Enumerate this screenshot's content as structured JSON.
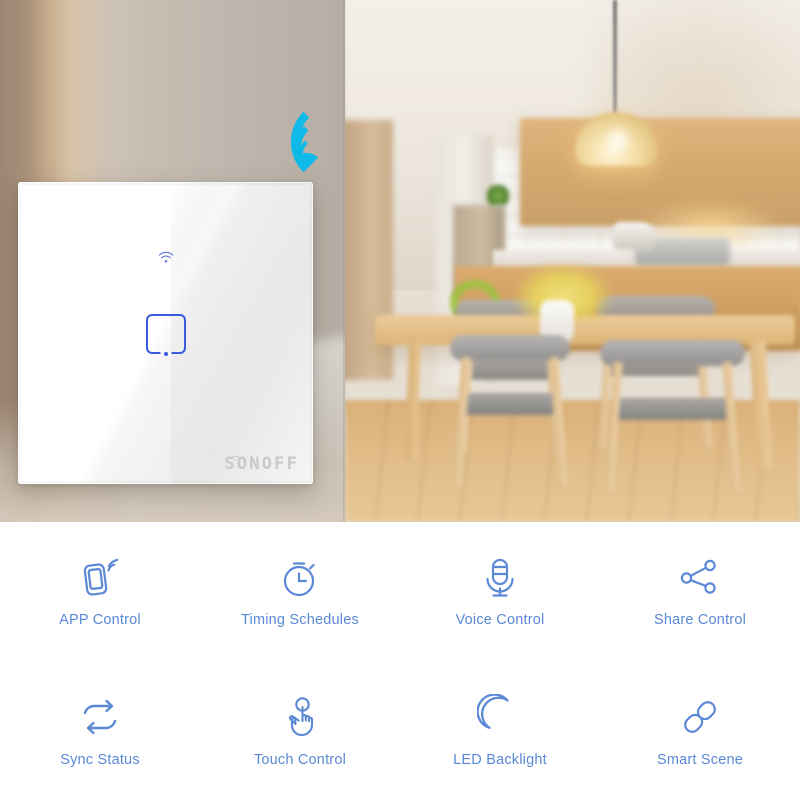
{
  "hero": {
    "wifi_emblem": {
      "icon": "wifi-signal-icon",
      "color": "#0fb9e8",
      "bars": 4
    },
    "scene_description": "Blurred modern kitchen and dining room interior with pendant lamp, wood cabinets, dining table and chairs"
  },
  "device": {
    "name": "sonoff-wall-switch",
    "brand": "SONOFF",
    "brand_color": "#c9c9c9",
    "panel_color": "#ffffff",
    "indicator_color": "#3b5bdb",
    "wifi_indicator": "wifi-icon",
    "touch_button": "touch-pad-button",
    "gang_count": 1
  },
  "features": {
    "accent_color": "#5b89d6",
    "items": [
      {
        "icon": "phone-wifi-icon",
        "label": "APP Control"
      },
      {
        "icon": "stopwatch-icon",
        "label": "Timing Schedules"
      },
      {
        "icon": "microphone-icon",
        "label": "Voice Control"
      },
      {
        "icon": "share-nodes-icon",
        "label": "Share Control"
      },
      {
        "icon": "sync-arrows-icon",
        "label": "Sync Status"
      },
      {
        "icon": "hand-tap-icon",
        "label": "Touch Control"
      },
      {
        "icon": "crescent-moon-icon",
        "label": "LED Backlight"
      },
      {
        "icon": "chain-link-icon",
        "label": "Smart Scene"
      }
    ]
  }
}
